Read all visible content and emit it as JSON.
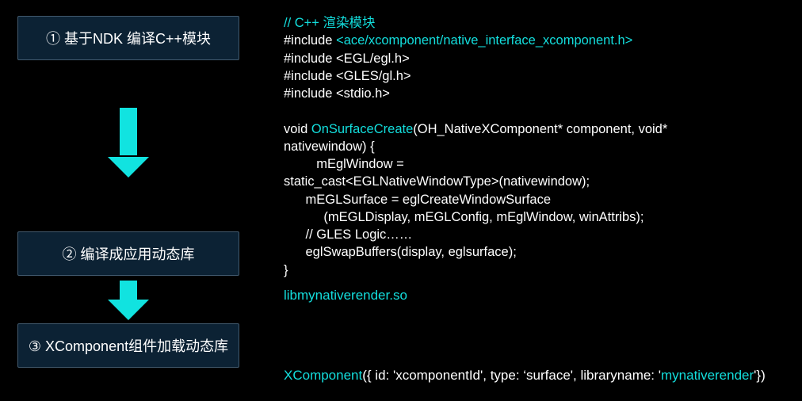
{
  "steps": {
    "s1": "① 基于NDK 编译C++模块",
    "s2": "② 编译成应用动态库",
    "s3": "③ XComponent组件加载动态库"
  },
  "code": {
    "comment": "// C++ 渲染模块",
    "include1_pre": "#include ",
    "include1_hl": "<ace/xcomponent/native_interface_xcomponent.h>",
    "include2": "#include <EGL/egl.h>",
    "include3": "#include <GLES/gl.h>",
    "include4": "#include <stdio.h>",
    "fn_pre": "void ",
    "fn_name": "OnSurfaceCreate",
    "fn_sig_tail": "(OH_NativeXComponent* component, void*",
    "l7": "nativewindow) {",
    "l8": "         mEglWindow =",
    "l9": "static_cast<EGLNativeWindowType>(nativewindow);",
    "l10": "      mEGLSurface = eglCreateWindowSurface",
    "l11": "           (mEGLDisplay, mEGLConfig, mEglWindow, winAttribs);",
    "l12": "      // GLES Logic……",
    "l13": "      eglSwapBuffers(display, eglsurface);",
    "l14": "}"
  },
  "library_output": "libmynativerender.so",
  "xcomponent": {
    "name": "XComponent",
    "params_pre": "({ id: 'xcomponentId', type: ‘surface',  libraryname: '",
    "libname": "mynativerender",
    "params_post": "'})"
  }
}
